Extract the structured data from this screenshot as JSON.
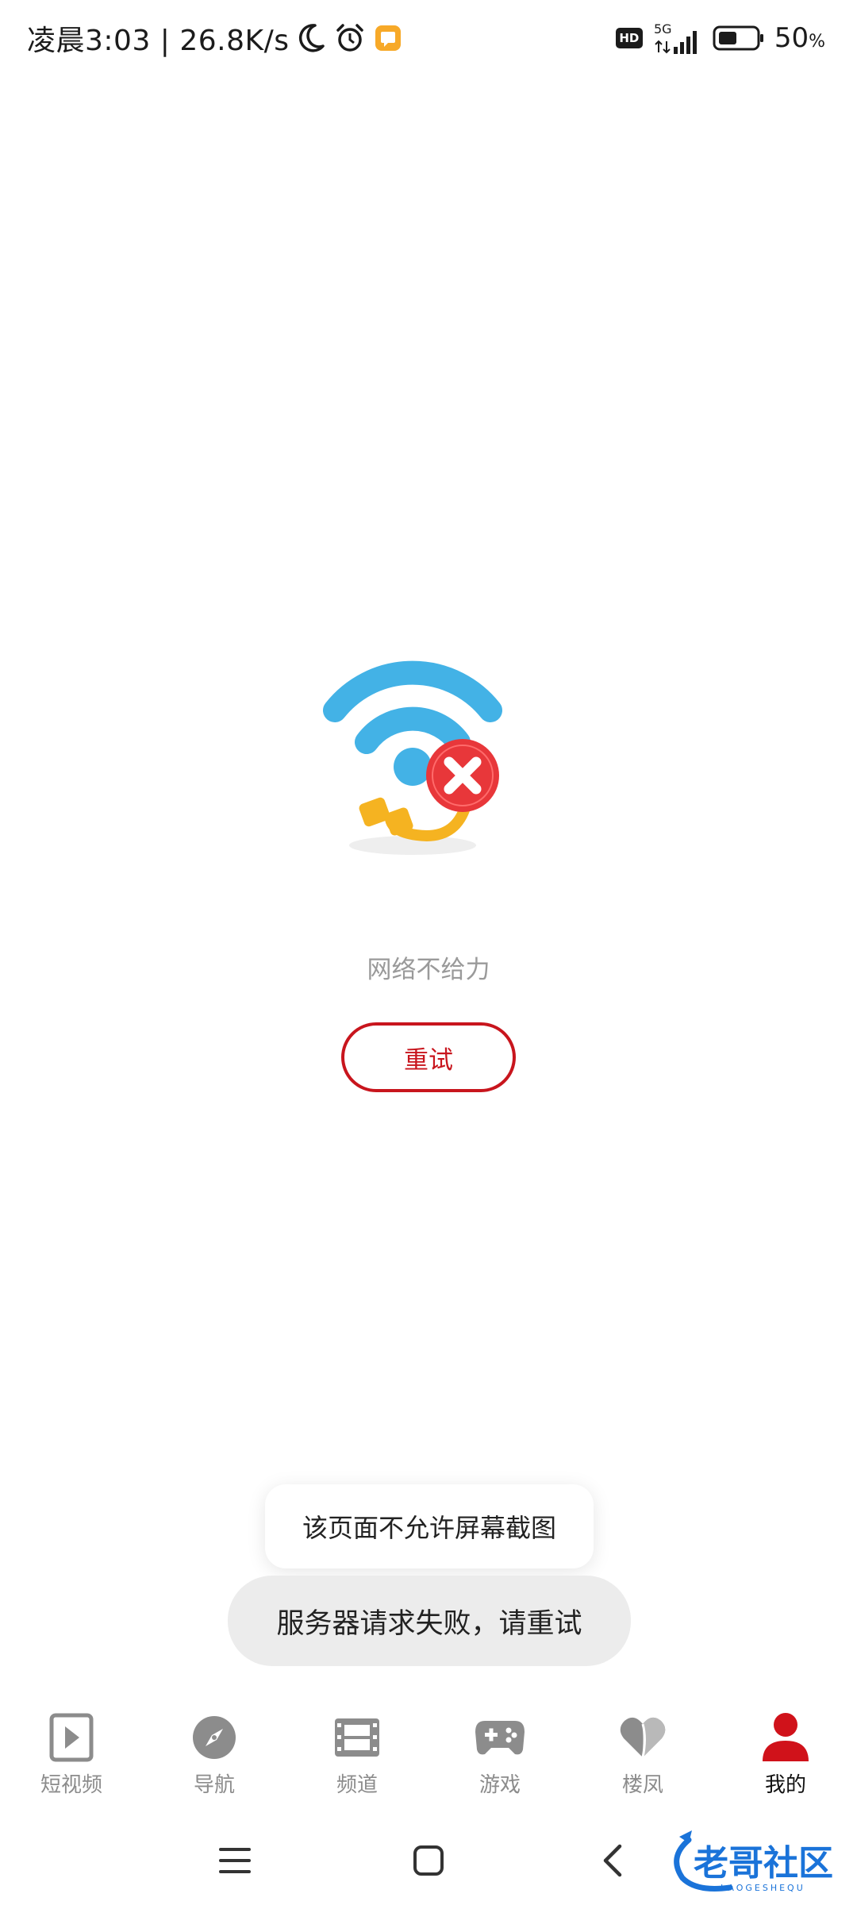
{
  "status_bar": {
    "time_speed": "凌晨3:03 | 26.8K/s",
    "hd": "HD",
    "network": "5G",
    "battery": "50",
    "battery_unit": "%"
  },
  "error": {
    "message": "网络不给力",
    "retry_label": "重试"
  },
  "toasts": {
    "screenshot_blocked": "该页面不允许屏幕截图",
    "server_failed": "服务器请求失败，请重试"
  },
  "bottom_nav": {
    "items": [
      {
        "label": "短视频",
        "icon": "play-square-icon"
      },
      {
        "label": "导航",
        "icon": "compass-icon"
      },
      {
        "label": "频道",
        "icon": "film-icon"
      },
      {
        "label": "游戏",
        "icon": "gamepad-icon"
      },
      {
        "label": "楼凤",
        "icon": "heart-icon"
      },
      {
        "label": "我的",
        "icon": "user-icon"
      }
    ],
    "active_index": 5
  },
  "watermark": {
    "title": "老哥社区",
    "subtitle": "LAOGESHEQU"
  },
  "colors": {
    "accent": "#c8151d",
    "wifi": "#43b2e6",
    "cable": "#f5b321",
    "icon_gray": "#8c8c8c"
  }
}
